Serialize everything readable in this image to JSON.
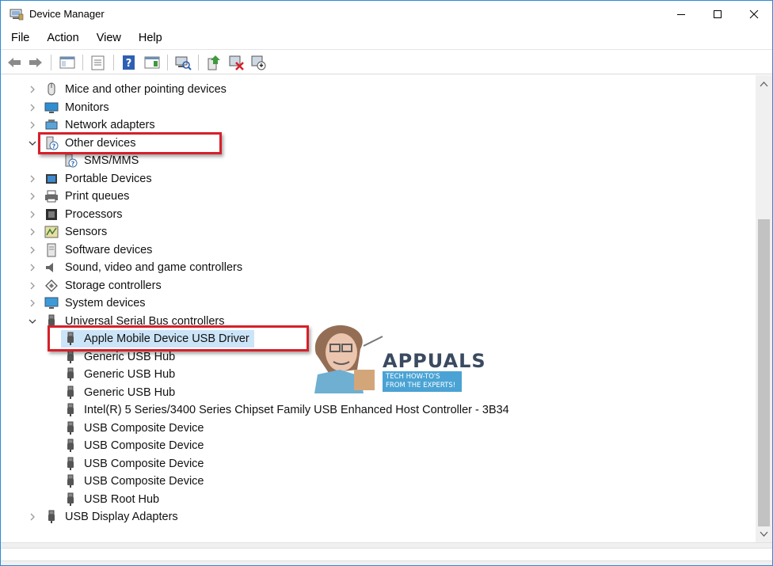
{
  "window": {
    "title": "Device Manager",
    "controls": [
      "minimize",
      "maximize",
      "close"
    ]
  },
  "menubar": {
    "items": [
      "File",
      "Action",
      "View",
      "Help"
    ]
  },
  "toolbar": {
    "buttons": [
      "back-icon",
      "forward-icon",
      "show-hide-console-tree-icon",
      "properties-icon",
      "help-icon",
      "action-pane-icon",
      "scan-hardware-icon",
      "update-driver-icon",
      "uninstall-device-icon",
      "disable-device-icon"
    ]
  },
  "tree": {
    "items": [
      {
        "label": "Mice and other pointing devices",
        "level": 0,
        "expanded": false,
        "icon": "mouse-icon"
      },
      {
        "label": "Monitors",
        "level": 0,
        "expanded": false,
        "icon": "monitor-icon"
      },
      {
        "label": "Network adapters",
        "level": 0,
        "expanded": false,
        "icon": "network-icon"
      },
      {
        "label": "Other devices",
        "level": 0,
        "expanded": true,
        "icon": "unknown-device-icon"
      },
      {
        "label": "SMS/MMS",
        "level": 1,
        "icon": "unknown-device-icon"
      },
      {
        "label": "Portable Devices",
        "level": 0,
        "expanded": false,
        "icon": "portable-device-icon"
      },
      {
        "label": "Print queues",
        "level": 0,
        "expanded": false,
        "icon": "printer-icon"
      },
      {
        "label": "Processors",
        "level": 0,
        "expanded": false,
        "icon": "processor-icon"
      },
      {
        "label": "Sensors",
        "level": 0,
        "expanded": false,
        "icon": "sensor-icon"
      },
      {
        "label": "Software devices",
        "level": 0,
        "expanded": false,
        "icon": "software-device-icon"
      },
      {
        "label": "Sound, video and game controllers",
        "level": 0,
        "expanded": false,
        "icon": "speaker-icon"
      },
      {
        "label": "Storage controllers",
        "level": 0,
        "expanded": false,
        "icon": "storage-icon"
      },
      {
        "label": "System devices",
        "level": 0,
        "expanded": false,
        "icon": "system-device-icon"
      },
      {
        "label": "Universal Serial Bus controllers",
        "level": 0,
        "expanded": true,
        "icon": "usb-icon"
      },
      {
        "label": "Apple Mobile Device USB Driver",
        "level": 1,
        "icon": "usb-icon",
        "selected": true
      },
      {
        "label": "Generic USB Hub",
        "level": 1,
        "icon": "usb-icon"
      },
      {
        "label": "Generic USB Hub",
        "level": 1,
        "icon": "usb-icon"
      },
      {
        "label": "Generic USB Hub",
        "level": 1,
        "icon": "usb-icon"
      },
      {
        "label": "Intel(R) 5 Series/3400 Series Chipset Family USB Enhanced Host Controller - 3B34",
        "level": 1,
        "icon": "usb-icon"
      },
      {
        "label": "USB Composite Device",
        "level": 1,
        "icon": "usb-icon"
      },
      {
        "label": "USB Composite Device",
        "level": 1,
        "icon": "usb-icon"
      },
      {
        "label": "USB Composite Device",
        "level": 1,
        "icon": "usb-icon"
      },
      {
        "label": "USB Composite Device",
        "level": 1,
        "icon": "usb-icon"
      },
      {
        "label": "USB Root Hub",
        "level": 1,
        "icon": "usb-icon"
      },
      {
        "label": "USB Display Adapters",
        "level": 0,
        "expanded": false,
        "icon": "usb-icon"
      }
    ]
  },
  "annotations": {
    "highlights": [
      "Other devices",
      "Apple Mobile Device USB Driver"
    ],
    "color": "#d6202a"
  },
  "watermark": {
    "brand": "APPUALS",
    "tagline": "TECH HOW-TO'S FROM THE EXPERTS!"
  },
  "colors": {
    "selection": "#cce4f7",
    "window_border": "#2b8bd6",
    "highlight": "#d6202a"
  }
}
